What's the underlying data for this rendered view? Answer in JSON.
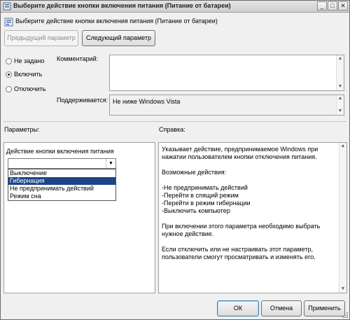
{
  "window": {
    "title": "Выберите действие кнопки включения питания (Питание от батареи)",
    "controls": {
      "minimize": "_",
      "maximize": "□",
      "close": "✕"
    }
  },
  "header": {
    "title": "Выберите действие кнопки включения питания (Питание от батареи)"
  },
  "nav": {
    "prev_label": "Предыдущий параметр",
    "next_label": "Следующий параметр"
  },
  "state": {
    "options": [
      {
        "label": "Не задано",
        "checked": false
      },
      {
        "label": "Включить",
        "checked": true
      },
      {
        "label": "Отключить",
        "checked": false
      }
    ]
  },
  "comment": {
    "label": "Комментарий:",
    "value": ""
  },
  "supported": {
    "label": "Поддерживается:",
    "value": "Не ниже Windows Vista"
  },
  "sections": {
    "params_label": "Параметры:",
    "help_label": "Справка:"
  },
  "params": {
    "field_label": "Действие кнопки включения питания",
    "combo_value": "",
    "dropdown_items": [
      "Выключение",
      "Гибернация",
      "Не предпринимать действий",
      "Режим сна"
    ],
    "selected_index": 1
  },
  "help": {
    "p1": "Указывает действие, предпринимаемое Windows при нажатии пользователем кнопки отключения питания.",
    "p2": "Возможные действия:",
    "actions": [
      "-Не предпринимать действий",
      "-Перейти в спящий режим",
      "-Перейти в режим гибернации",
      "-Выключить компьютер"
    ],
    "p3": "При включении этого параметра необходимо выбрать нужное действие.",
    "p4": "Если отключить или не настраивать этот параметр, пользователи смогут просматривать и изменять его."
  },
  "footer": {
    "ok_label": "ОК",
    "cancel_label": "Отмена",
    "apply_label": "Применить"
  },
  "colors": {
    "selection": "#1c4587",
    "title_bg": "#d9d9d9"
  }
}
